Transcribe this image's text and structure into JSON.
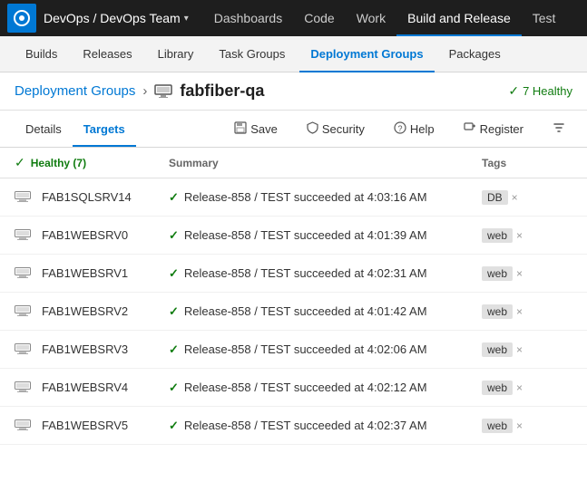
{
  "topNav": {
    "orgName": "DevOps / DevOps Team",
    "chevron": "▾",
    "items": [
      {
        "id": "dashboards",
        "label": "Dashboards",
        "active": false
      },
      {
        "id": "code",
        "label": "Code",
        "active": false
      },
      {
        "id": "work",
        "label": "Work",
        "active": false
      },
      {
        "id": "build-release",
        "label": "Build and Release",
        "active": true
      },
      {
        "id": "test",
        "label": "Test",
        "active": false
      }
    ]
  },
  "secondNav": {
    "items": [
      {
        "id": "builds",
        "label": "Builds",
        "active": false
      },
      {
        "id": "releases",
        "label": "Releases",
        "active": false
      },
      {
        "id": "library",
        "label": "Library",
        "active": false
      },
      {
        "id": "task-groups",
        "label": "Task Groups",
        "active": false
      },
      {
        "id": "deployment-groups",
        "label": "Deployment Groups",
        "active": true
      },
      {
        "id": "packages",
        "label": "Packages",
        "active": false
      }
    ]
  },
  "breadcrumb": {
    "link": "Deployment Groups",
    "separator": "›",
    "current": "fabfiber-qa"
  },
  "healthySummary": {
    "count": 7,
    "label": "Healthy"
  },
  "tabs": {
    "left": [
      {
        "id": "details",
        "label": "Details",
        "active": false
      },
      {
        "id": "targets",
        "label": "Targets",
        "active": true
      }
    ],
    "right": [
      {
        "id": "save",
        "icon": "💾",
        "label": "Save"
      },
      {
        "id": "security",
        "icon": "🛡",
        "label": "Security"
      },
      {
        "id": "help",
        "icon": "❓",
        "label": "Help"
      },
      {
        "id": "register",
        "icon": "🖥",
        "label": "Register"
      },
      {
        "id": "filter",
        "icon": "⚗",
        "label": ""
      }
    ]
  },
  "table": {
    "headers": {
      "name": "Healthy (7)",
      "summary": "Summary",
      "tags": "Tags"
    },
    "rows": [
      {
        "name": "FAB1SQLSRV14",
        "summary": "Release-858 / TEST succeeded at 4:03:16 AM",
        "tag": "DB"
      },
      {
        "name": "FAB1WEBSRV0",
        "summary": "Release-858 / TEST succeeded at 4:01:39 AM",
        "tag": "web"
      },
      {
        "name": "FAB1WEBSRV1",
        "summary": "Release-858 / TEST succeeded at 4:02:31 AM",
        "tag": "web"
      },
      {
        "name": "FAB1WEBSRV2",
        "summary": "Release-858 / TEST succeeded at 4:01:42 AM",
        "tag": "web"
      },
      {
        "name": "FAB1WEBSRV3",
        "summary": "Release-858 / TEST succeeded at 4:02:06 AM",
        "tag": "web"
      },
      {
        "name": "FAB1WEBSRV4",
        "summary": "Release-858 / TEST succeeded at 4:02:12 AM",
        "tag": "web"
      },
      {
        "name": "FAB1WEBSRV5",
        "summary": "Release-858 / TEST succeeded at 4:02:37 AM",
        "tag": "web"
      }
    ]
  },
  "icons": {
    "check": "✓",
    "server": "▣",
    "close": "×",
    "save": "💾",
    "shield": "⛨",
    "help": "?",
    "register": "⊞",
    "filter": "▽"
  }
}
